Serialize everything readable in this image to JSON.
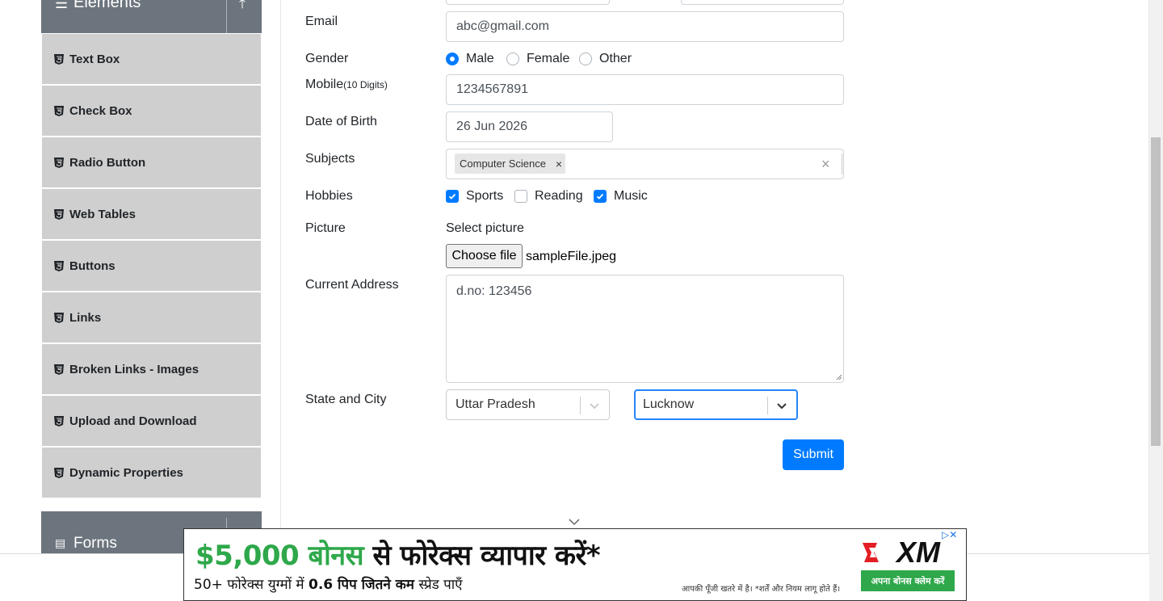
{
  "sidebar": {
    "elements_group": {
      "title": "Elements"
    },
    "items": [
      {
        "label": "Text Box"
      },
      {
        "label": "Check Box"
      },
      {
        "label": "Radio Button"
      },
      {
        "label": "Web Tables"
      },
      {
        "label": "Buttons"
      },
      {
        "label": "Links"
      },
      {
        "label": "Broken Links - Images"
      },
      {
        "label": "Upload and Download"
      },
      {
        "label": "Dynamic Properties"
      }
    ],
    "forms_group": {
      "title": "Forms"
    }
  },
  "form": {
    "email": {
      "label": "Email",
      "value": "abc@gmail.com"
    },
    "gender": {
      "label": "Gender",
      "options": [
        "Male",
        "Female",
        "Other"
      ],
      "selected": "Male"
    },
    "mobile": {
      "label": "Mobile",
      "hint": "(10 Digits)",
      "value": "1234567891"
    },
    "dob": {
      "label": "Date of Birth",
      "value": "26 Jun 2026"
    },
    "subjects": {
      "label": "Subjects",
      "chips": [
        "Computer Science"
      ],
      "remove_glyph": "×",
      "clear_glyph": "×"
    },
    "hobbies": {
      "label": "Hobbies",
      "options": [
        {
          "label": "Sports",
          "checked": true
        },
        {
          "label": "Reading",
          "checked": false
        },
        {
          "label": "Music",
          "checked": true
        }
      ]
    },
    "picture": {
      "label": "Picture",
      "select_label": "Select picture",
      "button": "Choose file",
      "file_name": "sampleFile.jpeg"
    },
    "address": {
      "label": "Current Address",
      "value": "d.no: 123456"
    },
    "state_city": {
      "label": "State and City",
      "state": "Uttar Pradesh",
      "city": "Lucknow"
    },
    "submit": "Submit"
  },
  "ad": {
    "headline_amount": "$5,000 बोनस",
    "headline_rest": " से फोरेक्स व्यापार करें*",
    "sub_prefix": "50+ फोरेक्स युग्मों में ",
    "sub_bold": "0.6 पिप जितने कम",
    "sub_suffix": " स्प्रेड पाएँ",
    "risk_note": "आपकी पूँजी खतरे में है। *शर्तें और नियम लागू होते हैं।",
    "brand": "XM",
    "cta": "अपना बोनस क्लेम करें",
    "ad_choices": "▷✕"
  },
  "colors": {
    "primary": "#007bff",
    "sidebar_header": "#6c757d",
    "menu_item": "#cfcfcf",
    "ad_green": "#2ea84a"
  }
}
